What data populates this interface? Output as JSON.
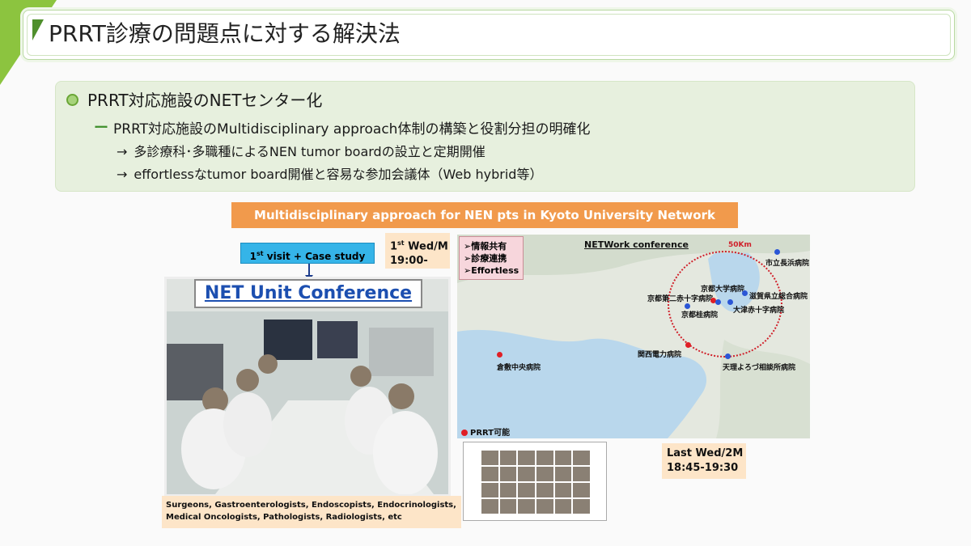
{
  "title": "PRRT診療の問題点に対する解決法",
  "bullets": {
    "level1": "PRRT対応施設のNETセンター化",
    "level2": "PRRT対応施設のMultidisciplinary approach体制の構築と役割分担の明確化",
    "arrow": "→",
    "level3a": "多診療科･多職種によるNEN tumor boardの設立と定期開催",
    "level3b": "effortlessなtumor board開催と容易な参加会議体（Web hybrid等）"
  },
  "figure": {
    "header": "Multidisciplinary approach for NEN pts in Kyoto University Network",
    "visit": {
      "pre": "1",
      "sup": "st",
      "post": " visit + Case study"
    },
    "wed1": {
      "pre": "1",
      "sup": "st",
      "post": " Wed/M",
      "time": "19:00-"
    },
    "net_unit": "NET Unit Conference",
    "members_line1": "Surgeons, Gastroenterologists, Endoscopists, Endocrinologists,",
    "members_line2": "Medical Oncologists, Pathologists, Radiologists, etc",
    "tags": [
      "➢情報共有",
      "➢診療連携",
      "➢Effortless"
    ],
    "network_title": "NETWork conference",
    "radius": "50Km",
    "hospitals": {
      "nagahama": "市立長浜病院",
      "kyodai": "京都大学病院",
      "daini": "京都第二赤十字病院",
      "shiga": "滋賀県立総合病院",
      "otsu": "大津赤十字病院",
      "katsura": "京都桂病院",
      "kanden": "関西電力病院",
      "tenri": "天理よろづ相談所病院",
      "kurashiki": "倉敷中央病院"
    },
    "legend": "PRRT可能",
    "wed2": {
      "line1": "Last Wed/2M",
      "line2": "18:45-19:30"
    }
  },
  "colors": {
    "accent": "#8cc43f",
    "orange": "#f19a4c",
    "peach": "#fde5c8",
    "prrt_red": "#e01f26",
    "hospital_blue": "#2a56d6"
  }
}
